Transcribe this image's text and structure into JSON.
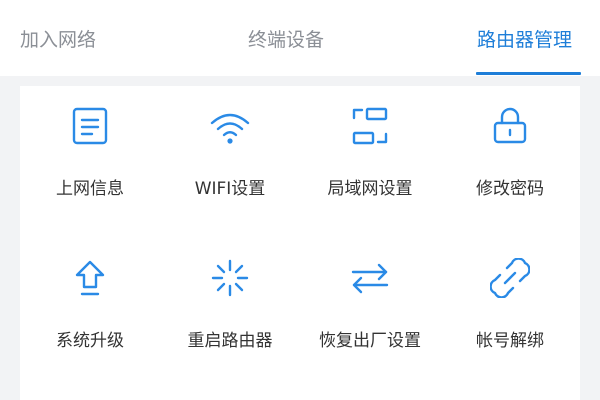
{
  "tabs": [
    {
      "label": "加入网络",
      "active": false
    },
    {
      "label": "终端设备",
      "active": false
    },
    {
      "label": "路由器管理",
      "active": true
    }
  ],
  "accent_color": "#1e7ed8",
  "grid": {
    "items": [
      {
        "label": "上网信息",
        "icon": "document-icon"
      },
      {
        "label": "WIFI设置",
        "icon": "wifi-icon"
      },
      {
        "label": "局域网设置",
        "icon": "lan-frame-icon"
      },
      {
        "label": "修改密码",
        "icon": "lock-icon"
      },
      {
        "label": "系统升级",
        "icon": "upgrade-arrow-icon"
      },
      {
        "label": "重启路由器",
        "icon": "restart-spinner-icon"
      },
      {
        "label": "恢复出厂设置",
        "icon": "reset-arrows-icon"
      },
      {
        "label": "帐号解绑",
        "icon": "unlink-icon"
      }
    ]
  }
}
